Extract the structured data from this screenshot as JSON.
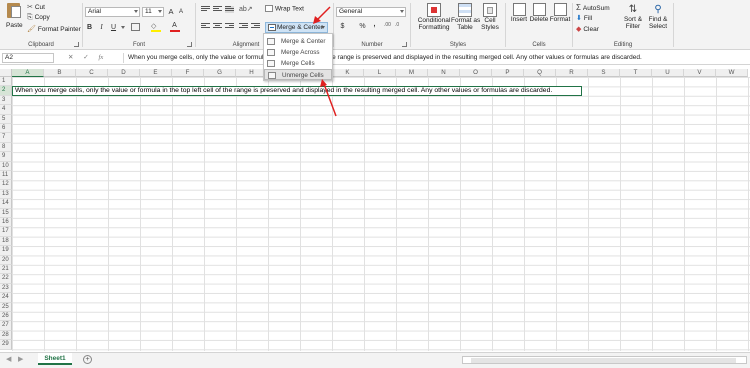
{
  "clipboard": {
    "paste": "Paste",
    "cut": "Cut",
    "copy": "Copy",
    "format_painter": "Format Painter",
    "label": "Clipboard"
  },
  "font": {
    "name": "Arial",
    "size": "11",
    "grow": "A",
    "shrink": "A",
    "bold": "B",
    "italic": "I",
    "underline": "U",
    "font_color_letter": "A",
    "label": "Font"
  },
  "alignment": {
    "wrap_text": "Wrap Text",
    "merge_center": "Merge & Center",
    "label": "Alignment"
  },
  "merge_menu": [
    "Merge & Center",
    "Merge Across",
    "Merge Cells",
    "Unmerge Cells"
  ],
  "number": {
    "format": "General",
    "currency": "$",
    "percent": "%",
    "comma": ",",
    "label": "Number"
  },
  "styles": {
    "conditional_1": "Conditional",
    "conditional_2": "Formatting",
    "format_table_1": "Format as",
    "format_table_2": "Table",
    "cell_styles_1": "Cell",
    "cell_styles_2": "Styles",
    "label": "Styles"
  },
  "cells": {
    "insert": "Insert",
    "delete": "Delete",
    "format": "Format",
    "label": "Cells"
  },
  "editing": {
    "autosum": "AutoSum",
    "fill": "Fill",
    "clear": "Clear",
    "sort_1": "Sort &",
    "sort_2": "Filter",
    "find_1": "Find &",
    "find_2": "Select",
    "label": "Editing"
  },
  "formula_bar": {
    "name_box": "A2",
    "fx": "fx",
    "text": "When you merge cells, only the value or formula in the top left cell of the range is preserved and displayed in the resulting merged cell. Any other values or formulas are discarded."
  },
  "columns": [
    "A",
    "B",
    "C",
    "D",
    "E",
    "F",
    "G",
    "H",
    "I",
    "J",
    "K",
    "L",
    "M",
    "N",
    "O",
    "P",
    "Q",
    "R",
    "S",
    "T",
    "U",
    "V",
    "W"
  ],
  "rows": [
    "1",
    "2",
    "3",
    "4",
    "5",
    "6",
    "7",
    "8",
    "9",
    "10",
    "11",
    "12",
    "13",
    "14",
    "15",
    "16",
    "17",
    "18",
    "19",
    "20",
    "21",
    "22",
    "23",
    "24",
    "25",
    "26",
    "27",
    "28",
    "29"
  ],
  "cell_a2": "When you merge cells, only the value or formula in the top left cell of the range is preserved and displayed in the resulting merged cell. Any other values or formulas are discarded.",
  "sheet_tab": "Sheet1",
  "add_sheet": "+",
  "colors": {
    "excel_green": "#217346",
    "arrow_red": "#e02020",
    "merge_highlight": "#cfe3f5"
  }
}
